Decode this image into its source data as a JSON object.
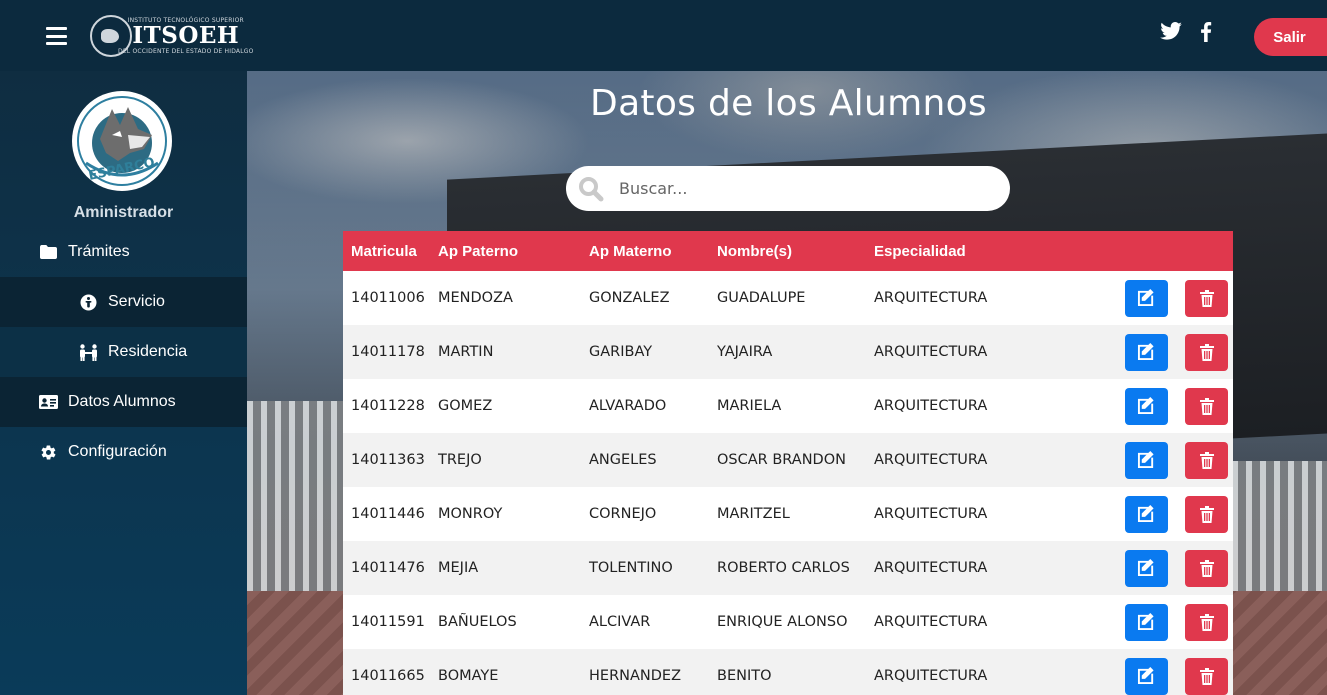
{
  "header": {
    "logo_small_top": "INSTITUTO TECNOLÓGICO SUPERIOR",
    "logo_name": "ITSOEH",
    "logo_small_bottom": "DEL OCCIDENTE DEL ESTADO DE HIDALGO",
    "social": [
      "twitter-icon",
      "facebook-icon"
    ],
    "logout_label": "Salir"
  },
  "sidebar": {
    "avatar_text": "ESPARCO",
    "user_name": "Aministrador",
    "items": [
      {
        "label": "Trámites",
        "icon": "folder-icon"
      },
      {
        "label": "Servicio",
        "icon": "info-circle-icon"
      },
      {
        "label": "Residencia",
        "icon": "people-icon"
      },
      {
        "label": "Datos Alumnos",
        "icon": "id-card-icon"
      },
      {
        "label": "Configuración",
        "icon": "gear-icon"
      }
    ]
  },
  "main": {
    "title": "Datos de los Alumnos",
    "search_placeholder": "Buscar...",
    "columns": [
      "Matricula",
      "Ap Paterno",
      "Ap Materno",
      "Nombre(s)",
      "Especialidad"
    ],
    "rows": [
      [
        "14011006",
        "MENDOZA",
        "GONZALEZ",
        "GUADALUPE",
        "ARQUITECTURA"
      ],
      [
        "14011178",
        "MARTIN",
        "GARIBAY",
        "YAJAIRA",
        "ARQUITECTURA"
      ],
      [
        "14011228",
        "GOMEZ",
        "ALVARADO",
        "MARIELA",
        "ARQUITECTURA"
      ],
      [
        "14011363",
        "TREJO",
        "ANGELES",
        "OSCAR BRANDON",
        "ARQUITECTURA"
      ],
      [
        "14011446",
        "MONROY",
        "CORNEJO",
        "MARITZEL",
        "ARQUITECTURA"
      ],
      [
        "14011476",
        "MEJIA",
        "TOLENTINO",
        "ROBERTO CARLOS",
        "ARQUITECTURA"
      ],
      [
        "14011591",
        "BAÑUELOS",
        "ALCIVAR",
        "ENRIQUE ALONSO",
        "ARQUITECTURA"
      ],
      [
        "14011665",
        "BOMAYE",
        "HERNANDEZ",
        "BENITO",
        "ARQUITECTURA"
      ]
    ],
    "edit_icon": "edit-icon",
    "delete_icon": "trash-icon"
  },
  "colors": {
    "topbar": "#0c2a3e",
    "accent_red": "#e0384d",
    "edit_blue": "#0a7af0"
  }
}
